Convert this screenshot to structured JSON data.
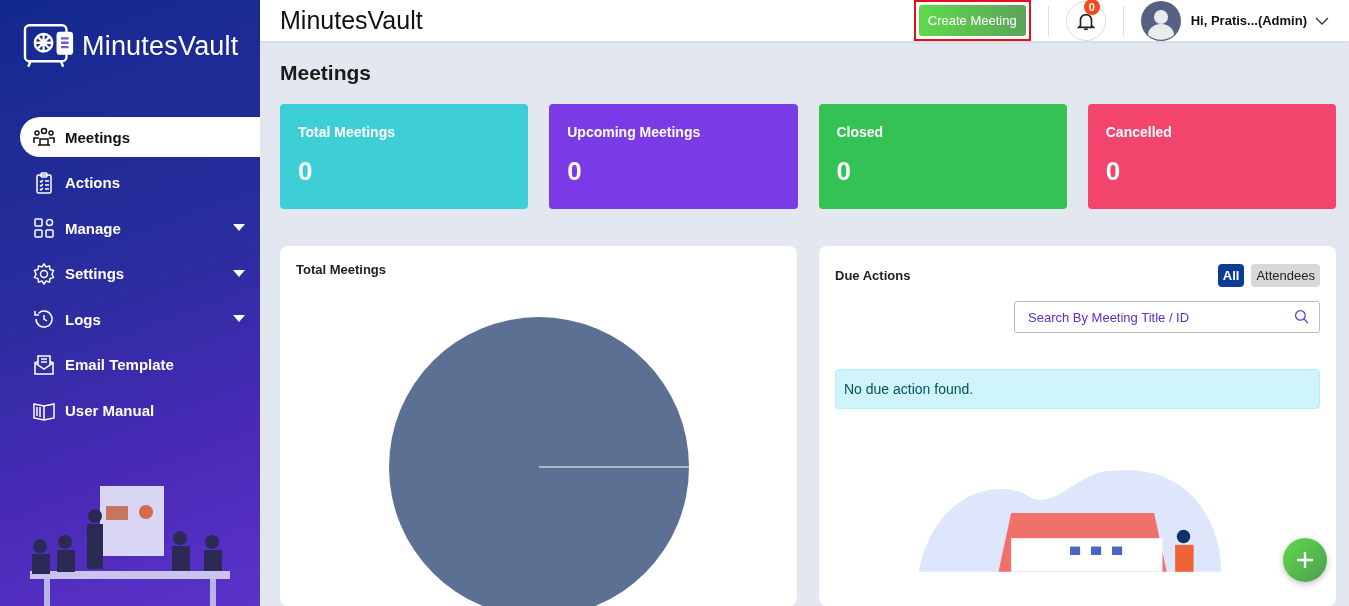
{
  "sidebar": {
    "logo": "MinutesVault",
    "items": [
      {
        "label": "Meetings",
        "selected": true,
        "has_caret": false
      },
      {
        "label": "Actions",
        "selected": false,
        "has_caret": false
      },
      {
        "label": "Manage",
        "selected": false,
        "has_caret": true
      },
      {
        "label": "Settings",
        "selected": false,
        "has_caret": true
      },
      {
        "label": "Logs",
        "selected": false,
        "has_caret": true
      },
      {
        "label": "Email Template",
        "selected": false,
        "has_caret": false
      },
      {
        "label": "User Manual",
        "selected": false,
        "has_caret": false
      }
    ]
  },
  "header": {
    "title": "MinutesVault",
    "create_button": "Create Meeting",
    "notification_count": "0",
    "user": "Hi, Pratis...(Admin)"
  },
  "page_title": "Meetings",
  "stats": [
    {
      "label": "Total Meetings",
      "value": "0",
      "color": "#3ecfd6"
    },
    {
      "label": "Upcoming Meetings",
      "value": "0",
      "color": "#7a3be6"
    },
    {
      "label": "Closed",
      "value": "0",
      "color": "#35c254"
    },
    {
      "label": "Cancelled",
      "value": "0",
      "color": "#f2456d"
    }
  ],
  "chart_panel": {
    "title": "Total Meetings"
  },
  "due_actions": {
    "title": "Due Actions",
    "filters": [
      {
        "label": "All",
        "selected": true
      },
      {
        "label": "Attendees",
        "selected": false
      }
    ],
    "search": {
      "placeholder": "Search By Meeting Title / ID"
    },
    "empty_message": "No due action found."
  }
}
